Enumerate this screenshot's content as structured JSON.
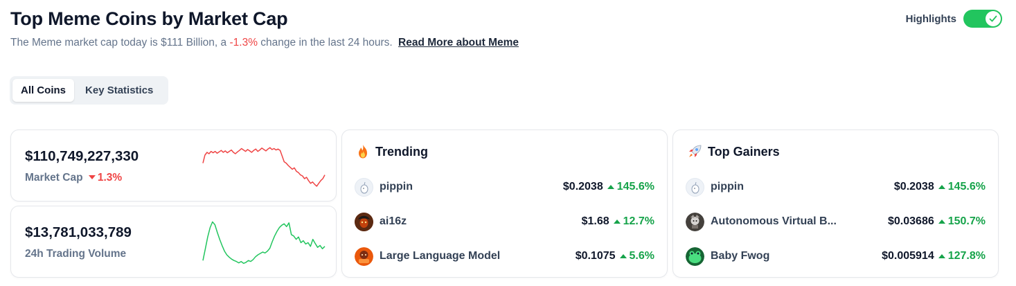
{
  "header": {
    "title": "Top Meme Coins by Market Cap",
    "subtitle_prefix": "The Meme market cap today is $111 Billion, a",
    "subtitle_change": "-1.3%",
    "subtitle_suffix": "change in the last 24 hours.",
    "read_more": "Read More about Meme"
  },
  "highlights": {
    "label": "Highlights",
    "enabled": true,
    "color": "#22c55e"
  },
  "tabs": [
    {
      "label": "All Coins",
      "active": true
    },
    {
      "label": "Key Statistics",
      "active": false
    }
  ],
  "stats": {
    "market_cap": {
      "value": "$110,749,227,330",
      "label": "Market Cap",
      "change": "1.3%",
      "direction": "down",
      "color": "#ef4444",
      "sparkline": [
        0.55,
        0.72,
        0.78,
        0.75,
        0.8,
        0.77,
        0.8,
        0.76,
        0.79,
        0.82,
        0.78,
        0.81,
        0.77,
        0.8,
        0.83,
        0.78,
        0.75,
        0.79,
        0.82,
        0.86,
        0.83,
        0.8,
        0.84,
        0.81,
        0.78,
        0.82,
        0.85,
        0.8,
        0.83,
        0.87,
        0.84,
        0.81,
        0.85,
        0.88,
        0.84,
        0.86,
        0.83,
        0.85,
        0.82,
        0.7,
        0.58,
        0.55,
        0.5,
        0.46,
        0.42,
        0.45,
        0.38,
        0.35,
        0.3,
        0.28,
        0.22,
        0.25,
        0.18,
        0.12,
        0.15,
        0.1,
        0.06,
        0.12,
        0.18,
        0.22,
        0.3
      ]
    },
    "volume": {
      "value": "$13,781,033,789",
      "label": "24h Trading Volume",
      "color": "#22c55e",
      "sparkline": [
        0.1,
        0.35,
        0.6,
        0.8,
        0.92,
        0.86,
        0.7,
        0.55,
        0.42,
        0.3,
        0.22,
        0.17,
        0.13,
        0.1,
        0.08,
        0.05,
        0.08,
        0.04,
        0.06,
        0.1,
        0.08,
        0.12,
        0.18,
        0.22,
        0.25,
        0.28,
        0.26,
        0.3,
        0.36,
        0.5,
        0.62,
        0.72,
        0.8,
        0.85,
        0.88,
        0.82,
        0.9,
        0.65,
        0.62,
        0.55,
        0.6,
        0.48,
        0.52,
        0.45,
        0.48,
        0.4,
        0.55,
        0.46,
        0.38,
        0.42,
        0.35,
        0.4
      ]
    }
  },
  "trending": {
    "title": "Trending",
    "icon": "flame-icon",
    "items": [
      {
        "name": "pippin",
        "price": "$0.2038",
        "change": "145.6%",
        "icon": "pippin-icon"
      },
      {
        "name": "ai16z",
        "price": "$1.68",
        "change": "12.7%",
        "icon": "ai16z-icon"
      },
      {
        "name": "Large Language Model",
        "price": "$0.1075",
        "change": "5.6%",
        "icon": "llm-icon"
      }
    ]
  },
  "gainers": {
    "title": "Top Gainers",
    "icon": "rocket-icon",
    "items": [
      {
        "name": "pippin",
        "price": "$0.2038",
        "change": "145.6%",
        "icon": "pippin-icon"
      },
      {
        "name": "Autonomous Virtual B...",
        "price": "$0.03686",
        "change": "150.7%",
        "icon": "avb-icon"
      },
      {
        "name": "Baby Fwog",
        "price": "$0.005914",
        "change": "127.8%",
        "icon": "baby-fwog-icon"
      }
    ]
  }
}
